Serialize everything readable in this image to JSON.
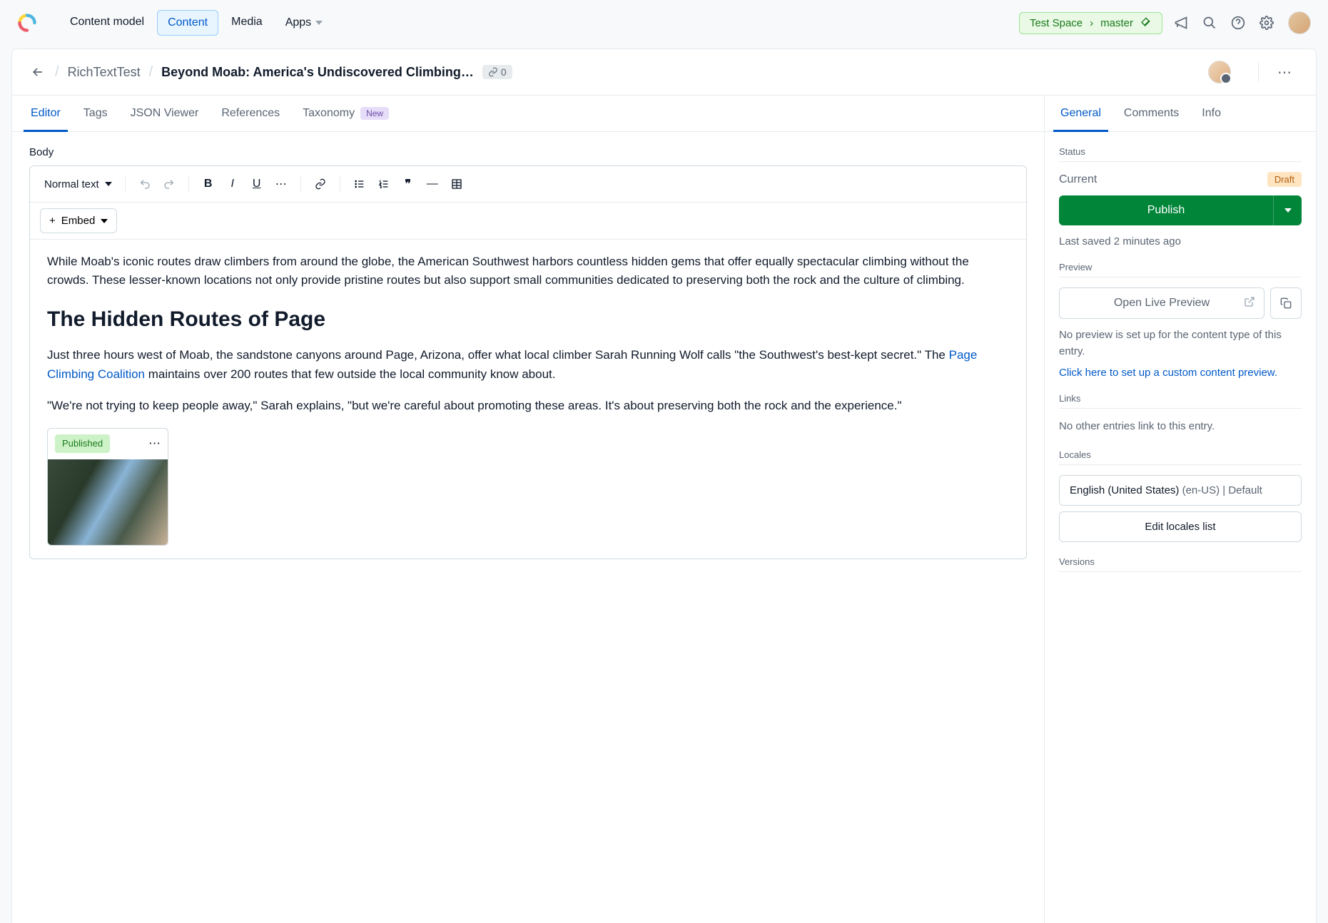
{
  "nav": {
    "content_model": "Content model",
    "content": "Content",
    "media": "Media",
    "apps": "Apps"
  },
  "space": {
    "name": "Test Space",
    "env": "master"
  },
  "breadcrumb": {
    "parent": "RichTextTest",
    "title": "Beyond Moab: America's Undiscovered Climbing…",
    "link_count": "0"
  },
  "tabs": {
    "editor": "Editor",
    "tags": "Tags",
    "json": "JSON Viewer",
    "references": "References",
    "taxonomy": "Taxonomy",
    "taxonomy_badge": "New"
  },
  "field": {
    "label": "Body"
  },
  "rte": {
    "text_style": "Normal text",
    "embed": "Embed"
  },
  "content": {
    "p1": "While Moab's iconic routes draw climbers from around the globe, the American Southwest harbors countless hidden gems that offer equally spectacular climbing without the crowds. These lesser-known locations not only provide pristine routes but also support small communities dedicated to preserving both the rock and the culture of climbing.",
    "h2": "The Hidden Routes of Page",
    "p2a": "Just three hours west of Moab, the sandstone canyons around Page, Arizona, offer what local climber Sarah Running Wolf calls \"the Southwest's best-kept secret.\" The ",
    "link_text": "Page Climbing Coalition",
    "p2b": " maintains over 200 routes that few outside the local community know about.",
    "p3": "\"We're not trying to keep people away,\" Sarah explains, \"but we're careful about promoting these areas. It's about preserving both the rock and the experience.\""
  },
  "embed_card": {
    "status": "Published"
  },
  "side_tabs": {
    "general": "General",
    "comments": "Comments",
    "info": "Info"
  },
  "status": {
    "section": "Status",
    "current_label": "Current",
    "draft": "Draft",
    "publish": "Publish",
    "saved": "Last saved 2 minutes ago"
  },
  "preview": {
    "section": "Preview",
    "open": "Open Live Preview",
    "none": "No preview is set up for the content type of this entry.",
    "setup": "Click here to set up a custom content preview."
  },
  "links": {
    "section": "Links",
    "none": "No other entries link to this entry."
  },
  "locales": {
    "section": "Locales",
    "name": "English (United States)",
    "meta": "(en-US) | Default",
    "edit": "Edit locales list"
  },
  "versions": {
    "section": "Versions"
  }
}
